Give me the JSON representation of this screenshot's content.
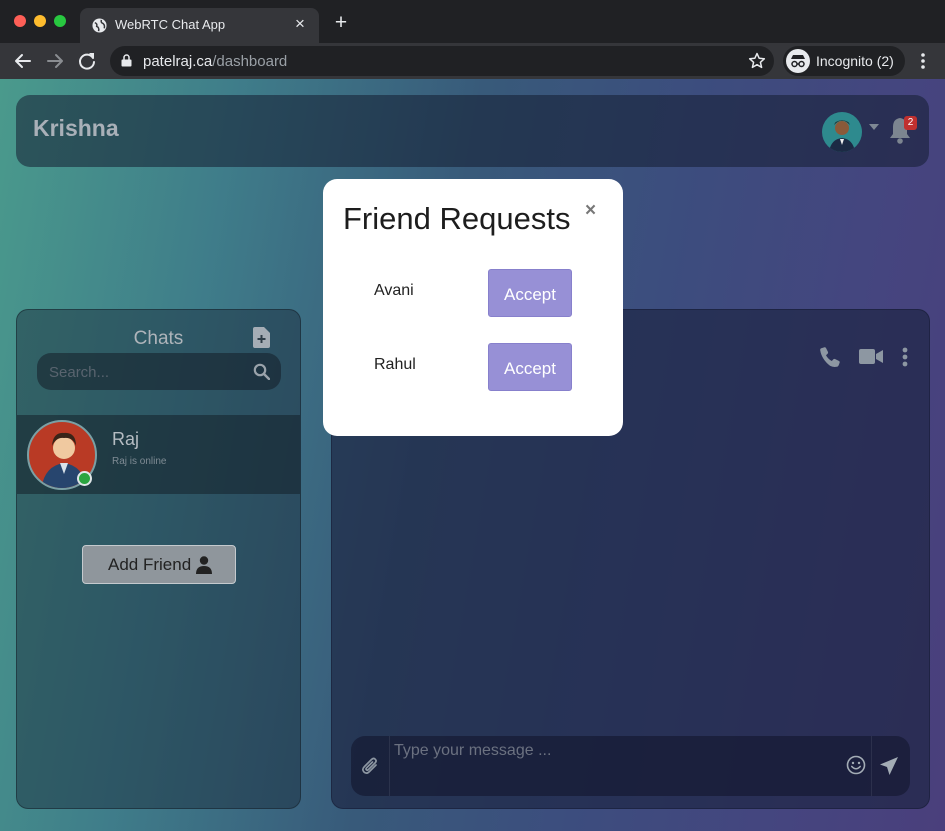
{
  "browser": {
    "tab_title": "WebRTC Chat App",
    "tab_close": "×",
    "new_tab": "+",
    "url_domain": "patelraj.ca",
    "url_path": "/dashboard",
    "incognito_label": "Incognito (2)"
  },
  "header": {
    "title": "Krishna",
    "notification_count": "2"
  },
  "sidebar": {
    "title": "Chats",
    "search_placeholder": "Search...",
    "chats": [
      {
        "name": "Raj",
        "status": "Raj is online"
      }
    ],
    "add_friend_label": "Add Friend"
  },
  "chat": {
    "message_placeholder": "Type your message ..."
  },
  "modal": {
    "title": "Friend Requests",
    "close": "×",
    "requests": [
      {
        "name": "Avani",
        "action": "Accept"
      },
      {
        "name": "Rahul",
        "action": "Accept"
      }
    ]
  },
  "colors": {
    "accent": "#9790d6",
    "online": "#2aa540",
    "badge": "#c0302f"
  }
}
